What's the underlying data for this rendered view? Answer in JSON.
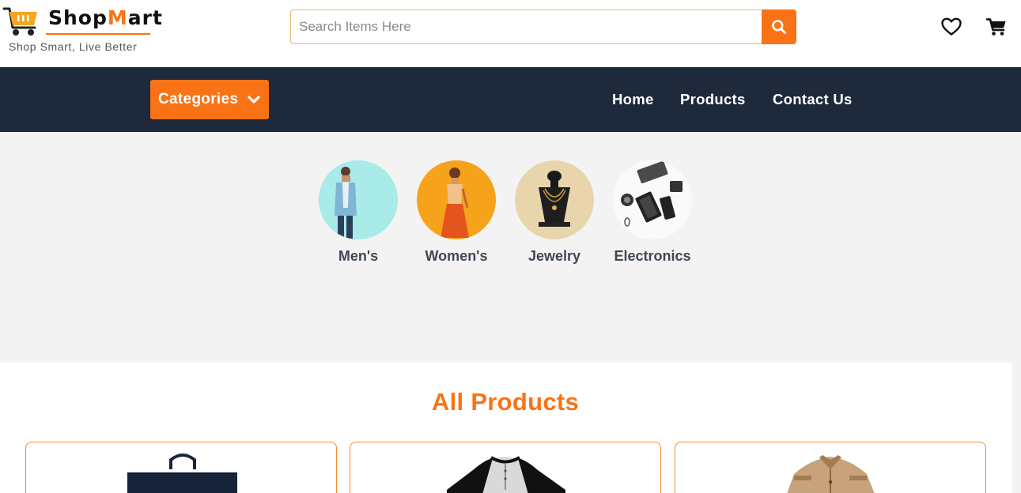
{
  "brand": {
    "name_prefix": "Shop",
    "name_highlight": "M",
    "name_suffix": "art",
    "tagline": "Shop Smart, Live Better"
  },
  "search": {
    "placeholder": "Search Items Here",
    "value": ""
  },
  "header_icons": [
    "heart-icon",
    "cart-icon"
  ],
  "nav": {
    "categories_label": "Categories",
    "links": [
      "Home",
      "Products",
      "Contact Us"
    ]
  },
  "categories": [
    {
      "label": "Men's"
    },
    {
      "label": "Women's"
    },
    {
      "label": "Jewelry"
    },
    {
      "label": "Electronics"
    }
  ],
  "products": {
    "title": "All Products",
    "items": [
      {
        "image": "navy-tote-bag"
      },
      {
        "image": "raglan-shirt"
      },
      {
        "image": "khaki-jacket"
      }
    ]
  },
  "colors": {
    "accent": "#f97316",
    "navbar": "#1e293b",
    "page_bg": "#f3f3f3"
  }
}
